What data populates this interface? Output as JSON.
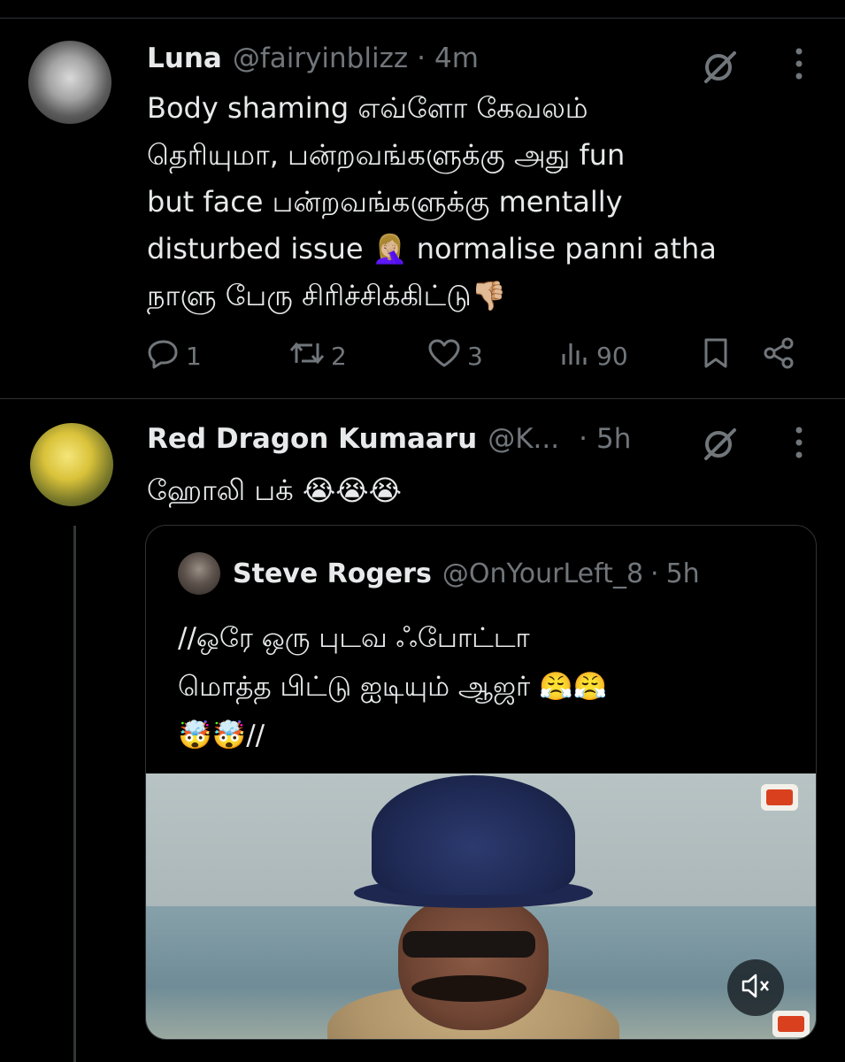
{
  "tweets": [
    {
      "display_name": "Luna",
      "handle": "@fairyinblizz",
      "separator": "·",
      "time": "4m",
      "text_lines": [
        "Body shaming எவ்ளோ கேவலம்",
        "தெரியுமா, பன்றவங்களுக்கு அது fun",
        "but  face பன்றவங்களுக்கு mentally",
        "disturbed issue 🤦🏼‍♀️ normalise panni atha",
        "நாளு பேரு சிரிச்சிக்கிட்டு👎🏼"
      ],
      "actions": {
        "replies": "1",
        "reposts": "2",
        "likes": "3",
        "views": "90"
      }
    },
    {
      "display_name": "Red Dragon Kumaaru",
      "handle": "@K...",
      "separator": "·",
      "time": "5h",
      "text": "ஹோலி பக் 😭😭😭",
      "quote": {
        "display_name": "Steve Rogers",
        "handle": "@OnYourLeft_8",
        "separator": "·",
        "time": "5h",
        "text_lines": [
          "//ஒரே ஒரு புடவ ஃபோட்டா",
          "மொத்த பிட்டு ஐடியும் ஆஜர் 😤😤",
          "🤯🤯//"
        ]
      }
    }
  ],
  "icons": {
    "grok": "grok-icon",
    "more": "more-icon",
    "reply": "reply-icon",
    "repost": "repost-icon",
    "like": "like-icon",
    "views": "views-icon",
    "bookmark": "bookmark-icon",
    "share": "share-icon",
    "mute": "mute-icon"
  },
  "colors": {
    "background": "#000000",
    "text": "#e7e9ea",
    "muted": "#71767b",
    "border": "#2f3336"
  }
}
